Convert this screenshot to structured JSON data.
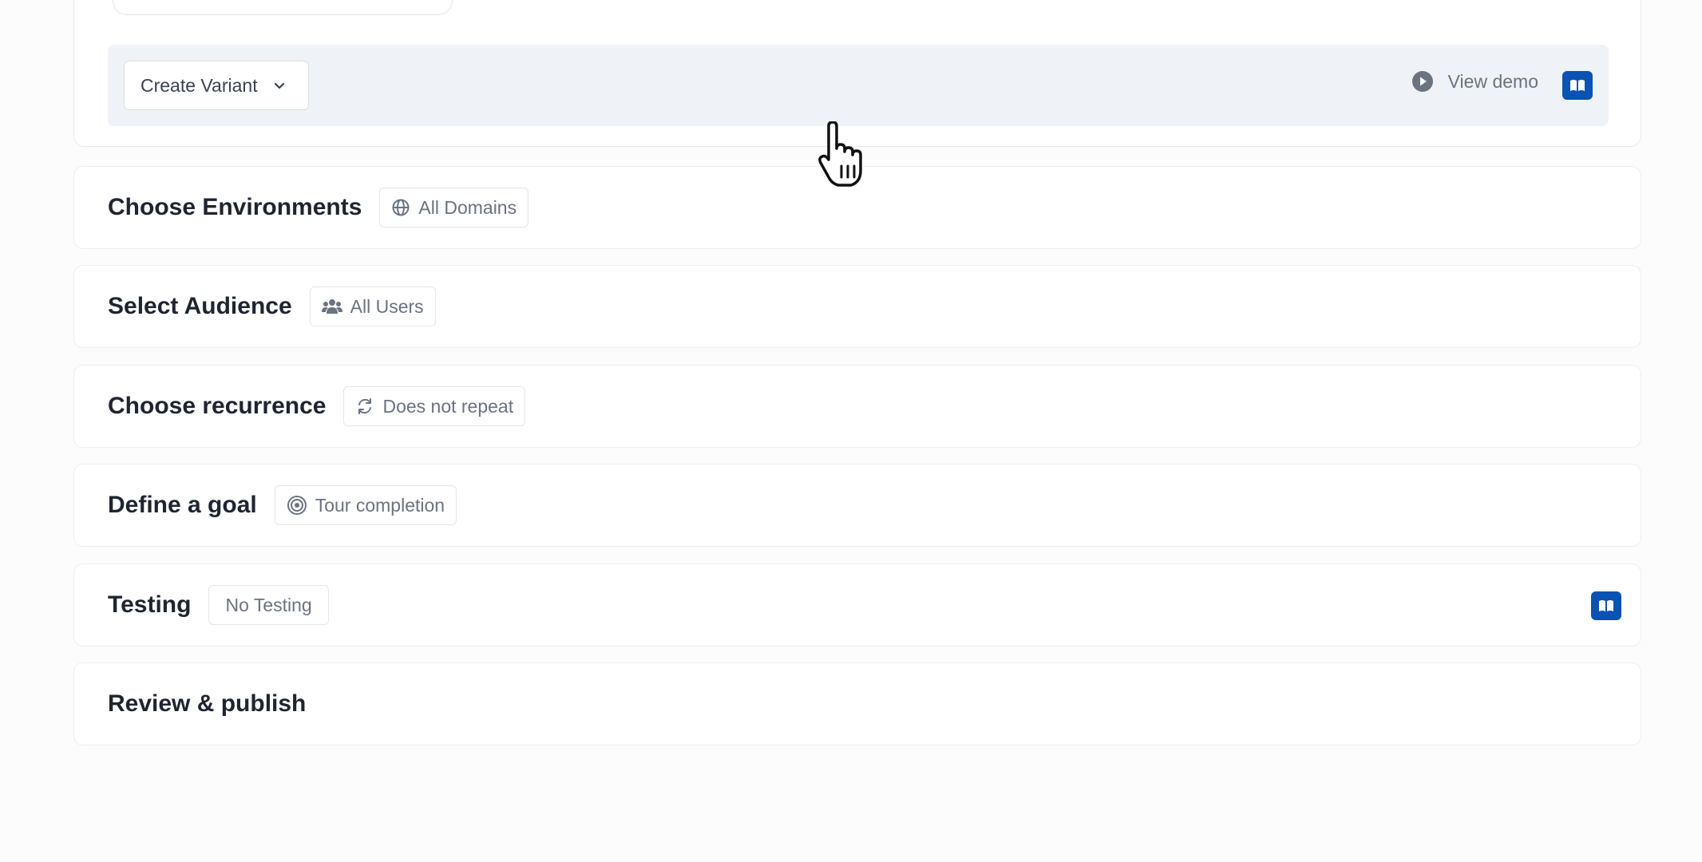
{
  "variant_bar": {
    "create_variant_label": "Create Variant",
    "view_demo_label": "View demo"
  },
  "steps": [
    {
      "title": "Choose Environments",
      "chip": "All Domains",
      "chip_icon": "globe-icon"
    },
    {
      "title": "Select Audience",
      "chip": "All Users",
      "chip_icon": "users-icon"
    },
    {
      "title": "Choose recurrence",
      "chip": "Does not repeat",
      "chip_icon": "repeat-icon"
    },
    {
      "title": "Define a goal",
      "chip": "Tour completion",
      "chip_icon": "target-icon"
    },
    {
      "title": "Testing",
      "chip": "No Testing",
      "chip_icon": ""
    },
    {
      "title": "Review & publish",
      "chip": "",
      "chip_icon": ""
    }
  ],
  "colors": {
    "accent": "#0a52b3",
    "variant_bar_bg": "#eff3f7",
    "muted_text": "#6b7280",
    "title_text": "#1f2430"
  }
}
